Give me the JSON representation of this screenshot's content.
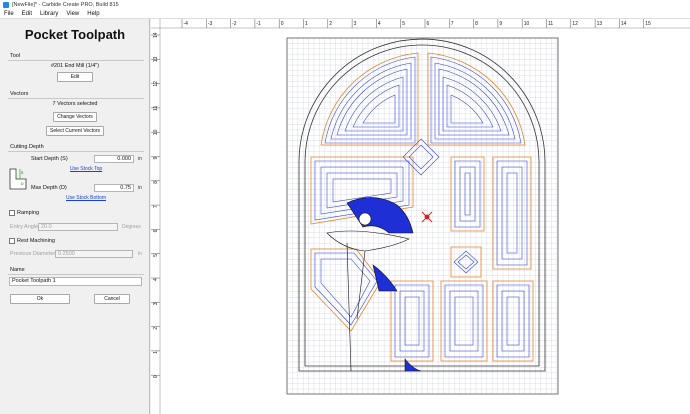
{
  "window": {
    "title": "[NewFile]* - Carbide Create PRO, Build 815"
  },
  "menu": [
    "File",
    "Edit",
    "Library",
    "View",
    "Help"
  ],
  "panel": {
    "title": "Pocket Toolpath",
    "tool": {
      "section": "Tool",
      "name": "#201 End Mill (1/4\")",
      "edit_label": "Edit"
    },
    "vectors": {
      "section": "Vectors",
      "selected": "7 Vectors selected",
      "change_label": "Change Vectors",
      "select_label": "Select Current Vectors"
    },
    "cutting_depth": {
      "section": "Cutting Depth",
      "start_label": "Start Depth (S)",
      "start_value": "0.000",
      "start_unit": "in",
      "use_stock_top": "Use Stock Top",
      "max_label": "Max Depth (D)",
      "max_value": "0.75",
      "max_unit": "in",
      "use_stock_bottom": "Use Stock Bottom"
    },
    "ramping": {
      "label": "Ramping",
      "entry_label": "Entry Angle",
      "entry_value": "20.0",
      "entry_unit": "Degrees"
    },
    "rest": {
      "label": "Rest Machining",
      "prev_label": "Previous Diameter",
      "prev_value": "0.2500",
      "prev_unit": "in"
    },
    "name": {
      "section": "Name",
      "value": "Pocket Toolpath 1"
    },
    "ok_label": "Ok",
    "cancel_label": "Cancel"
  },
  "ruler": {
    "x_labels": [
      "-4",
      "-3",
      "-2",
      "-1",
      "0",
      "1",
      "2",
      "3",
      "4",
      "5",
      "6",
      "7",
      "8",
      "9",
      "10",
      "11",
      "12",
      "13",
      "14",
      "15"
    ],
    "y_labels": [
      "14",
      "13",
      "12",
      "11",
      "10",
      "9",
      "8",
      "7",
      "6",
      "5",
      "4",
      "3",
      "2",
      "1",
      "0"
    ]
  },
  "colors": {
    "toolpath_blue": "#2b3fd6",
    "toolpath_orange": "#e8842a",
    "grid": "#c9cedc",
    "origin_red": "#d81e1e"
  }
}
